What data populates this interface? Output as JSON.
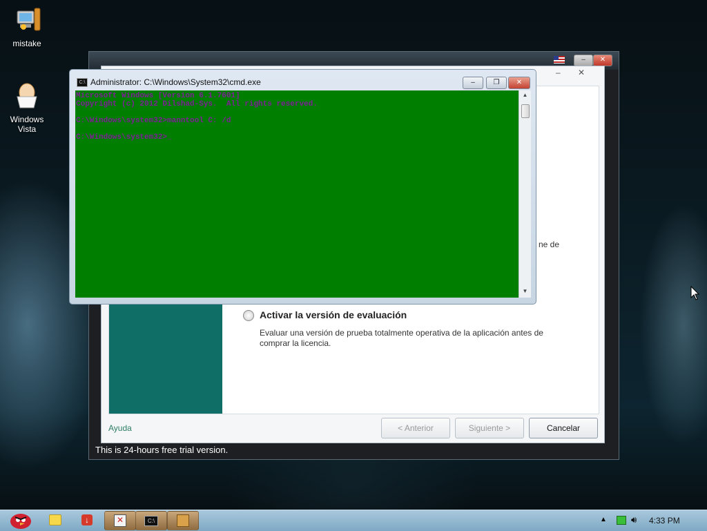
{
  "desktop": {
    "icons": [
      {
        "label": "mistake",
        "icon": "computer-icon"
      },
      {
        "label": "Windows\nVista",
        "icon": "egg-icon"
      }
    ]
  },
  "installer_window": {
    "status_text": "This is 24-hours free trial version.",
    "dialog": {
      "partial_text": "ne de",
      "option": {
        "title": "Activar la versión de evaluación",
        "description": "Evaluar una versión de prueba totalmente operativa de la aplicación antes de comprar la licencia."
      },
      "help_link": "Ayuda",
      "buttons": {
        "back": "< Anterior",
        "next": "Siguiente >",
        "cancel": "Cancelar"
      },
      "accent_color": "#0f6f66"
    }
  },
  "cmd_window": {
    "title": "Administrator: C:\\Windows\\System32\\cmd.exe",
    "console_bg": "#007e00",
    "console_fg": "#7c1f95",
    "lines": [
      "Microsoft Windows [Version 6.1.7601]",
      "Copyright (c) 2012 Dilshad-Sys.  All rights reserved.",
      "",
      "C:\\Windows\\system32>manntool C: /d",
      "",
      "C:\\Windows\\system32>_"
    ]
  },
  "taskbar": {
    "clock": "4:33 PM",
    "items": [
      "start-orb",
      "folder",
      "download",
      "app-1",
      "cmd",
      "package"
    ]
  }
}
